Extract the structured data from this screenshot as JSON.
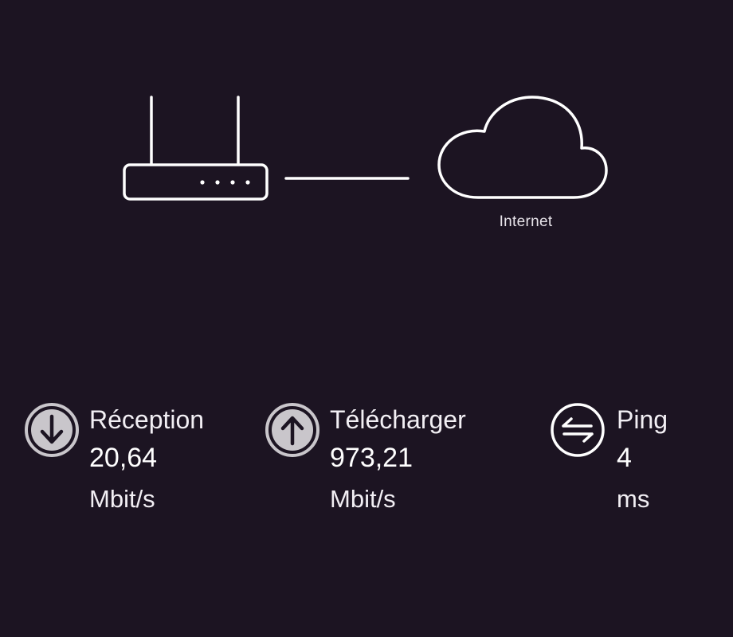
{
  "diagram": {
    "router_icon": "router-icon",
    "link": "connection-line",
    "cloud_icon": "cloud-icon",
    "internet_label": "Internet"
  },
  "stats": {
    "reception": {
      "icon": "arrow-down-circle-icon",
      "label": "Réception",
      "value": "20,64",
      "unit": "Mbit/s"
    },
    "upload": {
      "icon": "arrow-up-circle-icon",
      "label": "Télécharger",
      "value": "973,21",
      "unit": "Mbit/s"
    },
    "ping": {
      "icon": "swap-arrows-icon",
      "label": "Ping",
      "value": "4",
      "unit": "ms"
    }
  },
  "colors": {
    "background": "#1c1422",
    "icon_fill": "#c9c6cb",
    "text": "#ffffff"
  }
}
